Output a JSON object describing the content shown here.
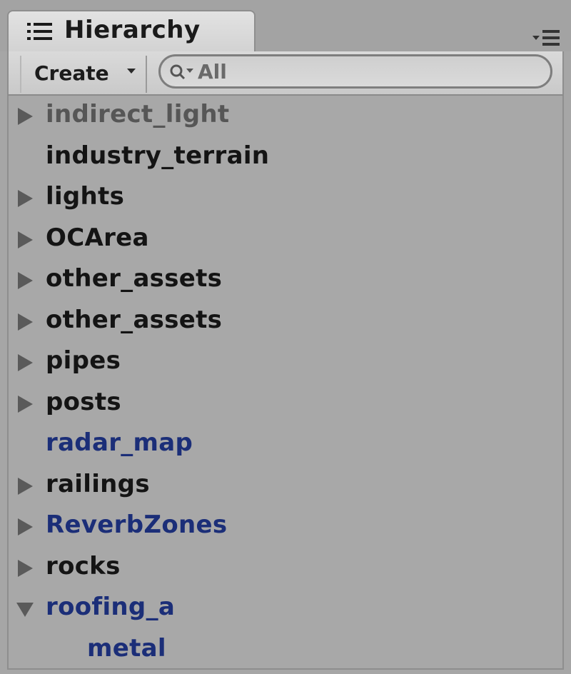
{
  "panel": {
    "title": "Hierarchy",
    "icon": "list-icon",
    "menu_icon": "panel-menu-icon"
  },
  "toolbar": {
    "create_label": "Create",
    "search_placeholder": "All"
  },
  "tree": {
    "items": [
      {
        "label": "indirect_light",
        "has_children": true,
        "expanded": false,
        "style": "muted"
      },
      {
        "label": "industry_terrain",
        "has_children": false,
        "expanded": false,
        "style": "normal"
      },
      {
        "label": "lights",
        "has_children": true,
        "expanded": false,
        "style": "normal"
      },
      {
        "label": "OCArea",
        "has_children": true,
        "expanded": false,
        "style": "normal"
      },
      {
        "label": "other_assets",
        "has_children": true,
        "expanded": false,
        "style": "normal"
      },
      {
        "label": "other_assets",
        "has_children": true,
        "expanded": false,
        "style": "normal"
      },
      {
        "label": "pipes",
        "has_children": true,
        "expanded": false,
        "style": "normal"
      },
      {
        "label": "posts",
        "has_children": true,
        "expanded": false,
        "style": "normal"
      },
      {
        "label": "radar_map",
        "has_children": false,
        "expanded": false,
        "style": "blue"
      },
      {
        "label": "railings",
        "has_children": true,
        "expanded": false,
        "style": "normal"
      },
      {
        "label": "ReverbZones",
        "has_children": true,
        "expanded": false,
        "style": "blue"
      },
      {
        "label": "rocks",
        "has_children": true,
        "expanded": false,
        "style": "normal"
      },
      {
        "label": "roofing_a",
        "has_children": true,
        "expanded": true,
        "style": "blue"
      },
      {
        "label": "metal",
        "has_children": false,
        "expanded": false,
        "style": "blue",
        "child": true
      }
    ]
  },
  "colors": {
    "background": "#a8a8a8",
    "text": "#141414",
    "muted_text": "#565656",
    "prefab_blue": "#1b2e78"
  }
}
